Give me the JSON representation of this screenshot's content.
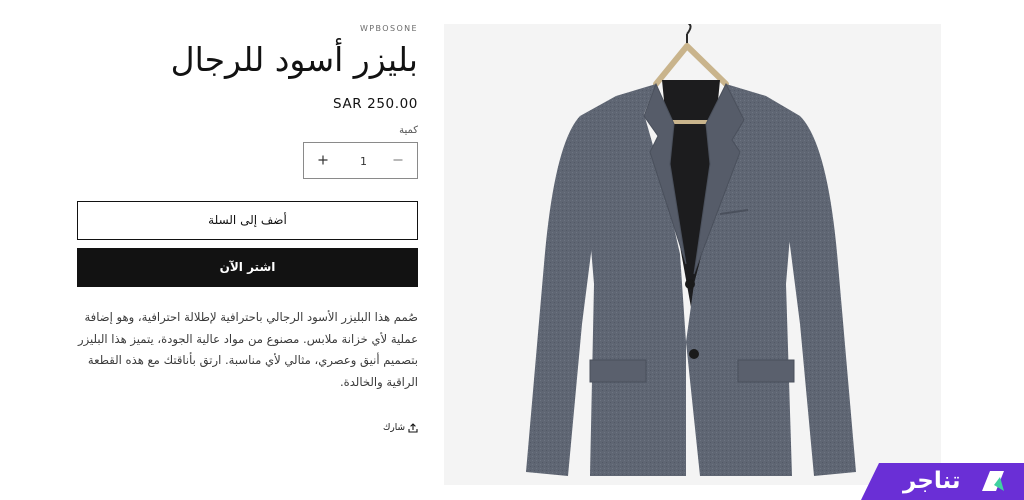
{
  "product": {
    "vendor": "WPBOSONE",
    "title": "بليزر أسود للرجال",
    "price": "SAR 250.00",
    "quantity_label": "كمية",
    "quantity_value": "1",
    "add_to_cart_label": "أضف إلى السلة",
    "buy_now_label": "اشتر الآن",
    "description": "صُمم هذا البليزر الأسود الرجالي باحترافية لإطلالة احترافية، وهو إضافة عملية لأي خزانة ملابس. مصنوع من مواد عالية الجودة، يتميز هذا البليزر بتصميم أنيق وعصري، مثالي لأي مناسبة. ارتق بأناقتك مع هذه القطعة الراقية والخالدة.",
    "share_label": "شارك"
  },
  "icons": {
    "plus": "plus-icon",
    "minus": "minus-icon",
    "share": "share-icon"
  },
  "brand_badge": {
    "text": "تناجر"
  },
  "colors": {
    "text": "#121212",
    "buy_now_bg": "#121212",
    "badge_bg": "#6a2fd6",
    "blazer": "#5f6673",
    "media_bg": "#f4f4f4"
  }
}
